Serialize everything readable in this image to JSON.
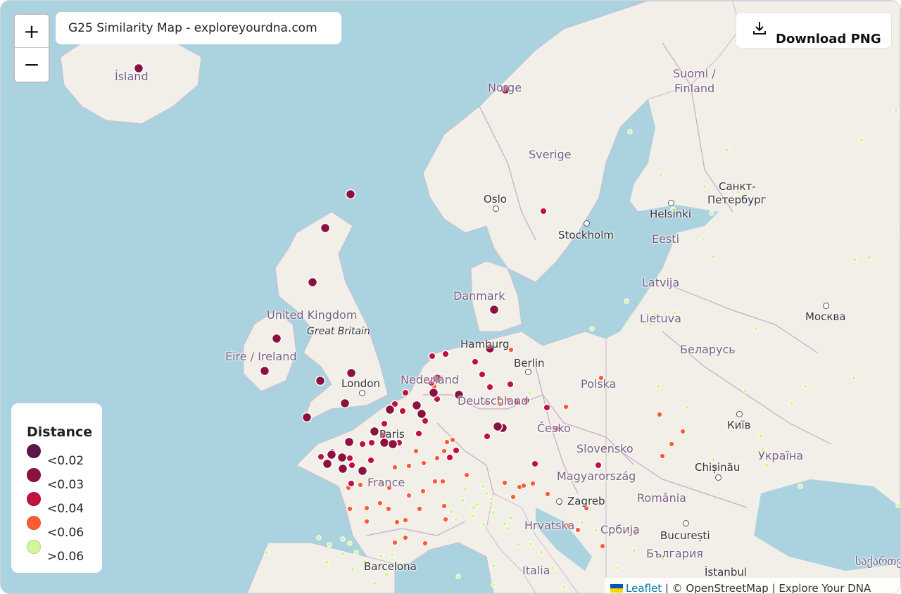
{
  "map": {
    "title": "G25 Similarity Map - exploreyourdna.com",
    "zoom_in_label": "+",
    "zoom_out_label": "−",
    "download_label": "Download PNG",
    "attribution": {
      "leaflet": "Leaflet",
      "rest": " | © OpenStreetMap | Explore Your DNA"
    },
    "colors": {
      "water": "#aad3df",
      "land": "#f2efe9",
      "lt002": "#5e1748",
      "lt003": "#8b1240",
      "lt004": "#c2103f",
      "lt006": "#ff5a36",
      "gt006": "#d4f79d"
    }
  },
  "legend": {
    "title": "Distance",
    "items": [
      {
        "label": "<0.02",
        "color": "#5e1748"
      },
      {
        "label": "<0.03",
        "color": "#8b1240"
      },
      {
        "label": "<0.04",
        "color": "#c2103f"
      },
      {
        "label": "<0.06",
        "color": "#ff5a36"
      },
      {
        "label": ">0.06",
        "color": "#d4f79d"
      }
    ]
  },
  "place_labels": {
    "island": "Ísland",
    "norge": "Norge",
    "sverige": "Sverige",
    "suomi": "Suomi /",
    "finland": "Finland",
    "spb1": "Санкт-",
    "spb2": "Петербург",
    "oslo": "Oslo",
    "stockholm": "Stockholm",
    "helsinki": "Helsinki",
    "eesti": "Eesti",
    "latvija": "Latvija",
    "danmark": "Danmark",
    "lietuva": "Lietuva",
    "moskva": "Москва",
    "uk": "United Kingdom",
    "gb": "Great Britain",
    "ireland": "Éire / Ireland",
    "hamburg": "Hamburg",
    "berlin": "Berlin",
    "belarus": "Беларусь",
    "london": "London",
    "nederland": "Nederland",
    "deutschland": "Deutschland",
    "polska": "Polska",
    "kyiv": "Київ",
    "paris": "Paris",
    "cesko": "Česko",
    "slovensko": "Slovensko",
    "ukraina": "Україна",
    "chisinau": "Chișinău",
    "france": "France",
    "magyar": "Magyarország",
    "zagreb": "Zagreb",
    "romania": "România",
    "hrvatska": "Hrvatska",
    "srbija": "Србија",
    "bucuresti": "București",
    "bulgaria": "България",
    "barcelona": "Barcelona",
    "italia": "Italia",
    "istanbul": "İstanbul",
    "georgia": "საქართველო"
  }
}
